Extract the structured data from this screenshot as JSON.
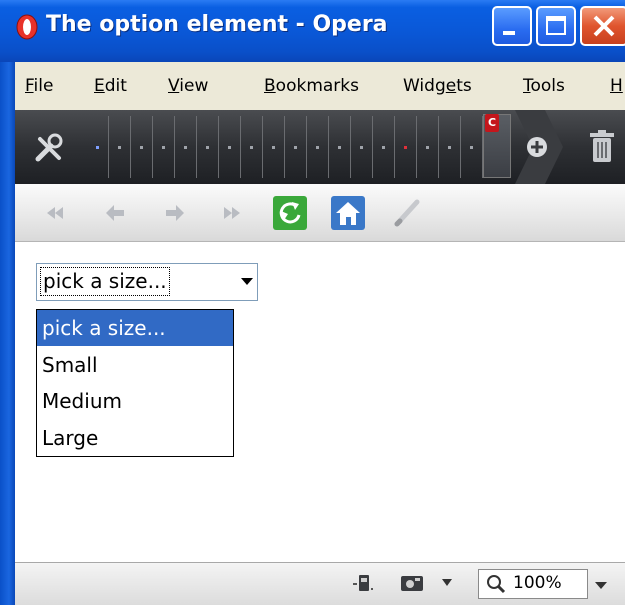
{
  "window": {
    "title": "The option element - Opera",
    "controls": [
      "minimize-icon",
      "maximize-icon",
      "close-icon"
    ]
  },
  "menu": {
    "items": [
      {
        "label": "File",
        "mnemonic": "F",
        "rest": "ile"
      },
      {
        "label": "Edit",
        "mnemonic": "E",
        "rest": "dit"
      },
      {
        "label": "View",
        "mnemonic": "V",
        "rest": "iew"
      },
      {
        "label": "Bookmarks",
        "mnemonic": "B",
        "rest": "ookmarks"
      },
      {
        "label": "Widgets",
        "pre": "Widg",
        "mnemonic": "e",
        "rest": "ts"
      },
      {
        "label": "Tools",
        "mnemonic": "T",
        "rest": "ools"
      },
      {
        "label": "H",
        "mnemonic": "H",
        "rest": ""
      }
    ]
  },
  "tabbar": {
    "icons": [
      "tools-icon",
      "new-tab-plus-icon",
      "trash-icon"
    ],
    "badge": "C"
  },
  "navbar": {
    "buttons": [
      "rewind-icon",
      "back-icon",
      "forward-icon",
      "fast-forward-icon",
      "reload-icon",
      "home-icon",
      "edit-icon"
    ]
  },
  "page": {
    "select": {
      "value": "pick a size..."
    },
    "options": [
      {
        "label": "pick a size...",
        "selected": true
      },
      {
        "label": "Small",
        "selected": false
      },
      {
        "label": "Medium",
        "selected": false
      },
      {
        "label": "Large",
        "selected": false
      }
    ]
  },
  "statusbar": {
    "icons": [
      "turbo-icon",
      "camera-icon",
      "zoom-search-icon"
    ],
    "zoom": "100%"
  },
  "colors": {
    "titlebar": "#0a57d6",
    "selection": "#316ac5",
    "close": "#e0552e"
  }
}
